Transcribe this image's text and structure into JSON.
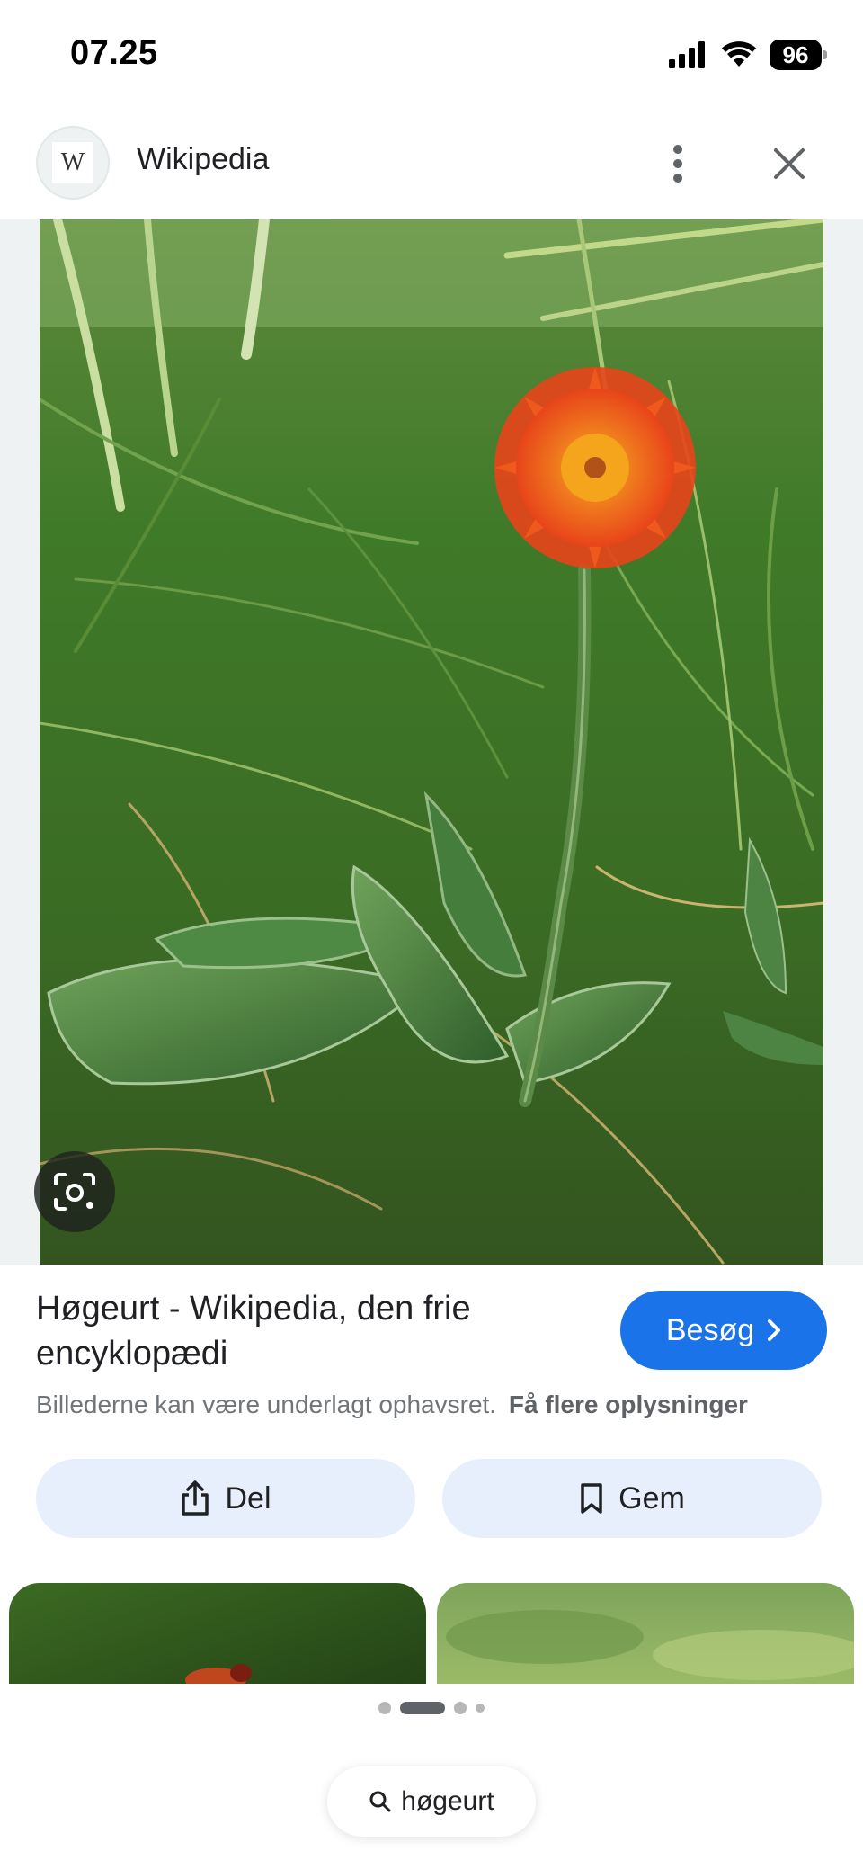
{
  "status_bar": {
    "time": "07.25",
    "battery": "96",
    "icons": [
      "signal-icon",
      "wifi-icon",
      "battery-icon"
    ]
  },
  "header": {
    "site_name": "Wikipedia",
    "logo_letter": "W",
    "icons": [
      "wikipedia-logo-icon",
      "more-vert-icon",
      "close-icon"
    ]
  },
  "image": {
    "subject": "orange hawkweed flower in grass",
    "lens_icon": "google-lens-icon"
  },
  "result": {
    "title": "Høgeurt - Wikipedia, den frie encyklopædi",
    "visit_label": "Besøg",
    "copyright_text": "Billederne kan være underlagt ophavsret.",
    "more_info_link": "Få flere oplysninger"
  },
  "actions": {
    "share_label": "Del",
    "save_label": "Gem"
  },
  "pagination": {
    "dot_count": 4,
    "active_index": 1
  },
  "search": {
    "query": "høgeurt"
  },
  "colors": {
    "accent": "#1a73e8",
    "action_button_bg": "#e8effc",
    "flower_orange": "#f05a1e"
  }
}
